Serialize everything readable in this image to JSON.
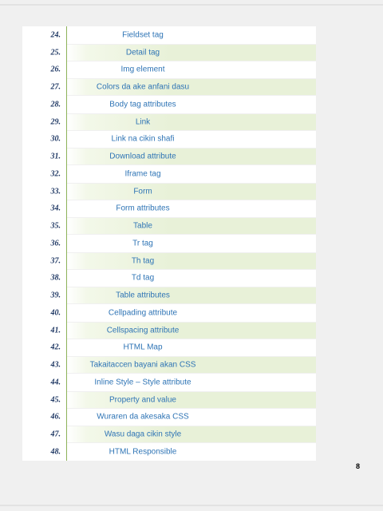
{
  "toc": {
    "rows": [
      {
        "num": "24.",
        "title": "Fieldset  tag",
        "shaded": false
      },
      {
        "num": "25.",
        "title": "Detail tag",
        "shaded": true
      },
      {
        "num": "26.",
        "title": "Img element",
        "shaded": false
      },
      {
        "num": "27.",
        "title": "Colors da ake anfani dasu",
        "shaded": true
      },
      {
        "num": "28.",
        "title": "Body tag attributes",
        "shaded": false
      },
      {
        "num": "29.",
        "title": "Link",
        "shaded": true
      },
      {
        "num": "30.",
        "title": "Link na cikin shafi",
        "shaded": false
      },
      {
        "num": "31.",
        "title": "Download attribute",
        "shaded": true
      },
      {
        "num": "32.",
        "title": "Iframe tag",
        "shaded": false
      },
      {
        "num": "33.",
        "title": "Form",
        "shaded": true
      },
      {
        "num": "34.",
        "title": "Form attributes",
        "shaded": false
      },
      {
        "num": "35.",
        "title": "Table",
        "shaded": true
      },
      {
        "num": "36.",
        "title": "Tr tag",
        "shaded": false
      },
      {
        "num": "37.",
        "title": "Th tag",
        "shaded": true
      },
      {
        "num": "38.",
        "title": "Td tag",
        "shaded": false
      },
      {
        "num": "39.",
        "title": "Table attributes",
        "shaded": true
      },
      {
        "num": "40.",
        "title": "Cellpading attribute",
        "shaded": false
      },
      {
        "num": "41.",
        "title": "Cellspacing attribute",
        "shaded": true
      },
      {
        "num": "42.",
        "title": "HTML Map",
        "shaded": false
      },
      {
        "num": "43.",
        "title": "Takaitaccen bayani akan CSS",
        "shaded": true
      },
      {
        "num": "44.",
        "title": "Inline Style – Style attribute",
        "shaded": false
      },
      {
        "num": "45.",
        "title": "Property and value",
        "shaded": true
      },
      {
        "num": "46.",
        "title": "Wuraren da akesaka CSS",
        "shaded": false
      },
      {
        "num": "47.",
        "title": "Wasu daga cikin style",
        "shaded": true
      },
      {
        "num": "48.",
        "title": "HTML Responsible",
        "shaded": false
      }
    ]
  },
  "footer": {
    "page_number": "8"
  },
  "colors": {
    "number_text": "#1f3864",
    "title_text": "#2e74b5",
    "shaded_row": "#e8f1d8",
    "divider": "#8db35a",
    "page_background": "#f0f0f0"
  }
}
